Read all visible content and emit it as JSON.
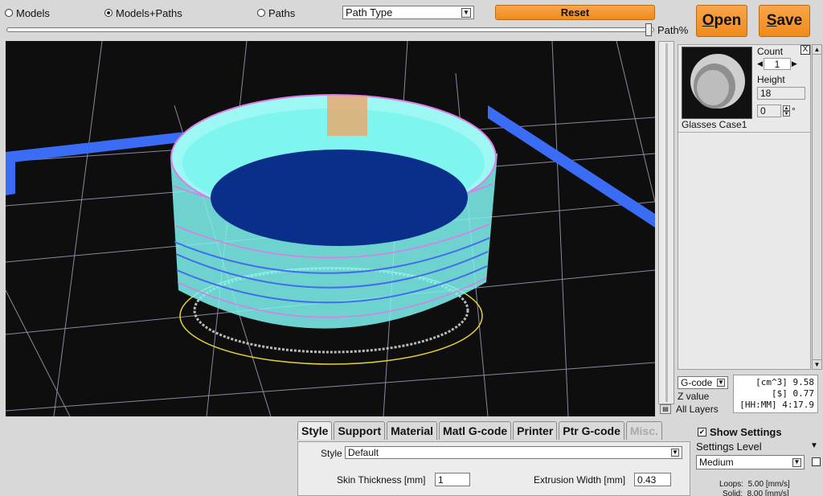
{
  "view_modes": {
    "models": "Models",
    "models_paths": "Models+Paths",
    "paths": "Paths",
    "selected": "models_paths"
  },
  "path_type_select": {
    "value": "Path Type"
  },
  "reset_button": "Reset",
  "open_button": {
    "prefix": "",
    "underline": "O",
    "rest": "pen"
  },
  "save_button": {
    "prefix": "",
    "underline": "S",
    "rest": "ave"
  },
  "path_percent": {
    "label": "Path%",
    "value_fraction": 1.0
  },
  "model": {
    "name": "Glasses Case1",
    "count_label": "Count",
    "count_value": "1",
    "height_label": "Height",
    "height_value": "18",
    "rotation_value": "0",
    "rotation_unit": "°",
    "close_label": "X"
  },
  "gcode": {
    "select_value": "G-code",
    "z_label": "Z value",
    "layers_label": "All Layers",
    "stats": [
      {
        "label": "[cm^3]",
        "value": "9.58"
      },
      {
        "label": "[$]",
        "value": "0.77"
      },
      {
        "label": "[HH:MM]",
        "value": "4:17.9"
      }
    ]
  },
  "tabs": [
    {
      "label": "Style",
      "active": true,
      "disabled": false
    },
    {
      "label": "Support",
      "active": false,
      "disabled": false
    },
    {
      "label": "Material",
      "active": false,
      "disabled": false
    },
    {
      "label": "Matl G-code",
      "active": false,
      "disabled": false
    },
    {
      "label": "Printer",
      "active": false,
      "disabled": false
    },
    {
      "label": "Ptr G-code",
      "active": false,
      "disabled": false
    },
    {
      "label": "Misc.",
      "active": false,
      "disabled": true
    }
  ],
  "style_pane": {
    "style_label": "Style",
    "style_value": "Default",
    "skin_label": "Skin Thickness [mm]",
    "skin_value": "1",
    "extrusion_label": "Extrusion Width [mm]",
    "extrusion_value": "0.43"
  },
  "settings": {
    "show_label": "Show Settings",
    "show_checked": true,
    "level_label": "Settings Level",
    "level_value": "Medium",
    "loops_line": "Loops:  5.00 [mm/s]",
    "solid_line": "Solid:  8.00 [mm/s]"
  },
  "colors": {
    "accent_orange": "#f08a1c",
    "viewport_bg": "#0e0e0e",
    "grid_line": "#8a8aa0",
    "bed_edge": "#3a6cf5",
    "model_cyan": "#7ff5f0",
    "model_blue": "#0a2f8a",
    "path_magenta": "#e07ae8",
    "outline_yellow": "#e6d23a"
  }
}
